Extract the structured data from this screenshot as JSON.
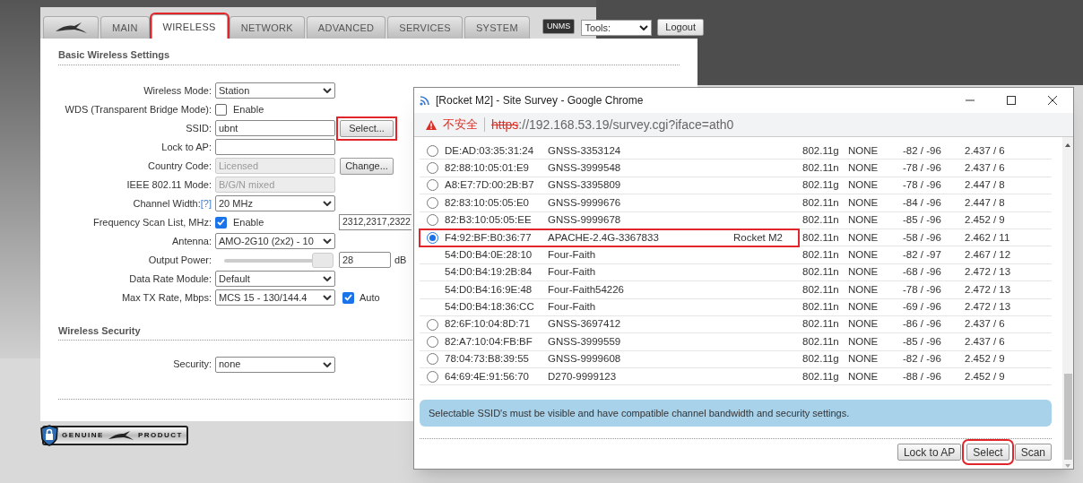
{
  "tabs": [
    {
      "kind": "logo",
      "selected": false,
      "highlighted": false
    },
    {
      "kind": "text",
      "label": "MAIN",
      "selected": false,
      "highlighted": false
    },
    {
      "kind": "text",
      "label": "WIRELESS",
      "selected": true,
      "highlighted": true
    },
    {
      "kind": "text",
      "label": "NETWORK",
      "selected": false,
      "highlighted": false
    },
    {
      "kind": "text",
      "label": "ADVANCED",
      "selected": false,
      "highlighted": false
    },
    {
      "kind": "text",
      "label": "SERVICES",
      "selected": false,
      "highlighted": false
    },
    {
      "kind": "text",
      "label": "SYSTEM",
      "selected": false,
      "highlighted": false
    }
  ],
  "header": {
    "unms_badge": "UNMS",
    "tools": "Tools:",
    "logout": "Logout"
  },
  "basic_section": {
    "title": "Basic Wireless Settings",
    "rows": [
      {
        "kind": "select",
        "label": "Wireless Mode:",
        "value": "Station"
      },
      {
        "kind": "checkbox",
        "label": "WDS (Transparent Bridge Mode):",
        "checked": false,
        "text": "Enable"
      },
      {
        "kind": "text",
        "label": "SSID:",
        "value": "ubnt",
        "select_button": "Select...",
        "highlighted": true
      },
      {
        "kind": "text",
        "label": "Lock to AP:"
      },
      {
        "kind": "disabled",
        "label": "Country Code:",
        "value": "Licensed",
        "change_button": "Change..."
      },
      {
        "kind": "disabled",
        "label": "IEEE 802.11 Mode:",
        "value": "B/G/N mixed"
      },
      {
        "kind": "select",
        "label": "Channel Width:",
        "help": "[?]",
        "value": "20 MHz"
      },
      {
        "kind": "checkbox",
        "label": "Frequency Scan List, MHz:",
        "checked": true,
        "text": "Enable",
        "extra": "2312,2317,2322"
      },
      {
        "kind": "select",
        "label": "Antenna:",
        "value": "AMO-2G10 (2x2) - 10"
      },
      {
        "kind": "slider",
        "label": "Output Power:",
        "level": 1,
        "value": "28",
        "unit": "dB"
      },
      {
        "kind": "select",
        "label": "Data Rate Module:",
        "value": "Default"
      },
      {
        "kind": "select",
        "label": "Max TX Rate, Mbps:",
        "value": "MCS 15 - 130/144.4",
        "checkbox": {
          "checked": true,
          "text": "Auto"
        }
      }
    ]
  },
  "security_section": {
    "title": "Wireless Security",
    "rows": [
      {
        "kind": "select",
        "label": "Security:",
        "value": "none"
      }
    ]
  },
  "genuine_badge": {
    "left": "GENUINE",
    "right": "PRODUCT"
  },
  "popup": {
    "title": "[Rocket M2] - Site Survey - Google Chrome",
    "url": {
      "warning": "不安全",
      "scheme": "https",
      "rest": "://192.168.53.19/survey.cgi?iface=ath0"
    },
    "rows": [
      {
        "selectable": true,
        "selected": false,
        "highlighted": false,
        "mac": "DE:AD:03:35:31:24",
        "ssid": "GNSS-3353124",
        "mode": "802.11g",
        "encryption": "NONE",
        "signal": "-82 / -96",
        "frequency": "2.437 / 6"
      },
      {
        "selectable": true,
        "selected": false,
        "highlighted": false,
        "mac": "82:88:10:05:01:E9",
        "ssid": "GNSS-3999548",
        "mode": "802.11n",
        "encryption": "NONE",
        "signal": "-78 / -96",
        "frequency": "2.437 / 6"
      },
      {
        "selectable": true,
        "selected": false,
        "highlighted": false,
        "mac": "A8:E7:7D:00:2B:B7",
        "ssid": "GNSS-3395809",
        "mode": "802.11g",
        "encryption": "NONE",
        "signal": "-78 / -96",
        "frequency": "2.447 / 8"
      },
      {
        "selectable": true,
        "selected": false,
        "highlighted": false,
        "mac": "82:83:10:05:05:E0",
        "ssid": "GNSS-9999676",
        "mode": "802.11n",
        "encryption": "NONE",
        "signal": "-84 / -96",
        "frequency": "2.447 / 8"
      },
      {
        "selectable": true,
        "selected": false,
        "highlighted": false,
        "mac": "82:B3:10:05:05:EE",
        "ssid": "GNSS-9999678",
        "mode": "802.11n",
        "encryption": "NONE",
        "signal": "-85 / -96",
        "frequency": "2.452 / 9"
      },
      {
        "selectable": true,
        "selected": true,
        "highlighted": true,
        "mac": "F4:92:BF:B0:36:77",
        "ssid": "APACHE-2.4G-3367833",
        "device": "Rocket M2",
        "mode": "802.11n",
        "encryption": "NONE",
        "signal": "-58 / -96",
        "frequency": "2.462 / 11"
      },
      {
        "selectable": false,
        "selected": false,
        "highlighted": false,
        "mac": "54:D0:B4:0E:28:10",
        "ssid": "Four-Faith",
        "mode": "802.11n",
        "encryption": "NONE",
        "signal": "-82 / -97",
        "frequency": "2.467 / 12"
      },
      {
        "selectable": false,
        "selected": false,
        "highlighted": false,
        "mac": "54:D0:B4:19:2B:84",
        "ssid": "Four-Faith",
        "mode": "802.11n",
        "encryption": "NONE",
        "signal": "-68 / -96",
        "frequency": "2.472 / 13"
      },
      {
        "selectable": false,
        "selected": false,
        "highlighted": false,
        "mac": "54:D0:B4:16:9E:48",
        "ssid": "Four-Faith54226",
        "mode": "802.11n",
        "encryption": "NONE",
        "signal": "-78 / -96",
        "frequency": "2.472 / 13"
      },
      {
        "selectable": false,
        "selected": false,
        "highlighted": false,
        "mac": "54:D0:B4:18:36:CC",
        "ssid": "Four-Faith",
        "mode": "802.11n",
        "encryption": "NONE",
        "signal": "-69 / -96",
        "frequency": "2.472 / 13"
      },
      {
        "selectable": true,
        "selected": false,
        "highlighted": false,
        "mac": "82:6F:10:04:8D:71",
        "ssid": "GNSS-3697412",
        "mode": "802.11n",
        "encryption": "NONE",
        "signal": "-86 / -96",
        "frequency": "2.437 / 6"
      },
      {
        "selectable": true,
        "selected": false,
        "highlighted": false,
        "mac": "82:A7:10:04:FB:BF",
        "ssid": "GNSS-3999559",
        "mode": "802.11n",
        "encryption": "NONE",
        "signal": "-85 / -96",
        "frequency": "2.437 / 6"
      },
      {
        "selectable": true,
        "selected": false,
        "highlighted": false,
        "mac": "78:04:73:B8:39:55",
        "ssid": "GNSS-9999608",
        "mode": "802.11g",
        "encryption": "NONE",
        "signal": "-82 / -96",
        "frequency": "2.452 / 9"
      },
      {
        "selectable": true,
        "selected": false,
        "highlighted": false,
        "mac": "64:69:4E:91:56:70",
        "ssid": "D270-9999123",
        "mode": "802.11g",
        "encryption": "NONE",
        "signal": "-88 / -96",
        "frequency": "2.452 / 9"
      }
    ],
    "info": "Selectable SSID's must be visible and have compatible channel bandwidth and security settings.",
    "buttons": [
      {
        "label": "Lock to AP",
        "highlighted": false
      },
      {
        "label": "Select",
        "highlighted": true
      },
      {
        "label": "Scan",
        "highlighted": false
      }
    ]
  }
}
